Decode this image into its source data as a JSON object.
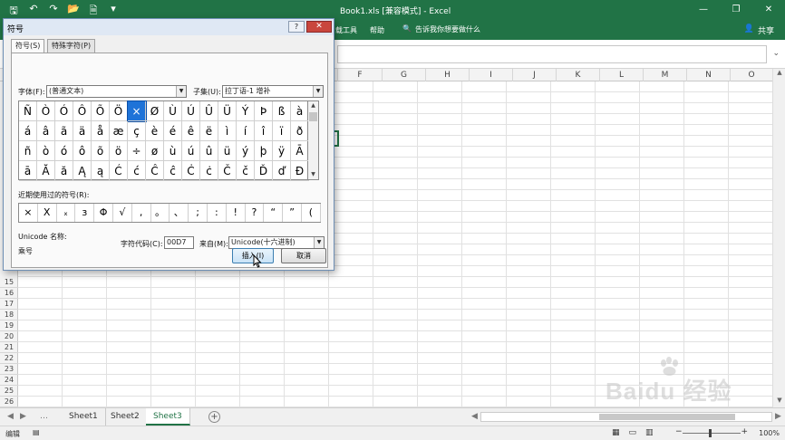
{
  "window": {
    "title": "Book1.xls  [兼容模式]  -  Excel",
    "minimize": "—",
    "restore": "❐",
    "close": "✕"
  },
  "qat": {
    "save": "🖫",
    "undo": "↶",
    "redo": "↷",
    "open": "📂",
    "print": "🗎",
    "more": "▾"
  },
  "ribbon": {
    "tabs": [
      "载工具",
      "帮助"
    ],
    "tell_me_icon": "🔍",
    "tell_me": "告诉我你想要做什么",
    "share_icon": "👤",
    "share": "共享"
  },
  "formula_bar": {
    "expand": "⌄"
  },
  "columns": [
    "F",
    "G",
    "H",
    "I",
    "J",
    "K",
    "L",
    "M",
    "N",
    "O"
  ],
  "rows": [
    "15",
    "16",
    "17",
    "18",
    "19",
    "20",
    "21",
    "22",
    "23",
    "24",
    "25",
    "26"
  ],
  "sheets": {
    "tabs": [
      "Sheet1",
      "Sheet2",
      "Sheet3"
    ],
    "active": "Sheet3",
    "add": "+",
    "nav_prev": "◀",
    "nav_next": "▶",
    "more_left": "…",
    "scroll_left": "◀",
    "scroll_right": "▶"
  },
  "status": {
    "mode": "编辑",
    "macro_icon": "▤",
    "zoom": "100%",
    "zoom_minus": "−",
    "zoom_plus": "+",
    "views": [
      "▦",
      "▭",
      "▥"
    ]
  },
  "dialog": {
    "title": "符号",
    "help": "?",
    "close": "✕",
    "tabs": [
      "符号(S)",
      "特殊字符(P)"
    ],
    "font_label": "字体(F):",
    "font_value": "(普通文本)",
    "subset_label": "子集(U):",
    "subset_value": "拉丁语-1 增补",
    "symbols": [
      [
        "Ñ",
        "Ò",
        "Ó",
        "Ô",
        "Õ",
        "Ö",
        "×",
        "Ø",
        "Ù",
        "Ú",
        "Û",
        "Ü",
        "Ý",
        "Þ",
        "ß",
        "à"
      ],
      [
        "á",
        "â",
        "ã",
        "ä",
        "å",
        "æ",
        "ç",
        "è",
        "é",
        "ê",
        "ë",
        "ì",
        "í",
        "î",
        "ï",
        "ð"
      ],
      [
        "ñ",
        "ò",
        "ó",
        "ô",
        "õ",
        "ö",
        "÷",
        "ø",
        "ù",
        "ú",
        "û",
        "ü",
        "ý",
        "þ",
        "ÿ",
        "Ā"
      ],
      [
        "ā",
        "Ă",
        "ă",
        "Ą",
        "ą",
        "Ć",
        "ć",
        "Ĉ",
        "ĉ",
        "Ċ",
        "ċ",
        "Č",
        "č",
        "Ď",
        "ď",
        "Đ"
      ]
    ],
    "selected_symbol": "×",
    "recent_label": "近期使用过的符号(R):",
    "recent": [
      "×",
      "X",
      "ₓ",
      "з",
      "Φ",
      "√",
      ",",
      "。",
      "、",
      ";",
      ":",
      "!",
      "?",
      "“",
      "”",
      "("
    ],
    "unicode_name_label": "Unicode 名称:",
    "unicode_name_value": "乘号",
    "code_label": "字符代码(C):",
    "code_value": "00D7",
    "from_label": "来自(M):",
    "from_value": "Unicode(十六进制)",
    "insert": "插入(I)",
    "cancel": "取消"
  },
  "watermark": {
    "text": "Baidu 经验"
  }
}
